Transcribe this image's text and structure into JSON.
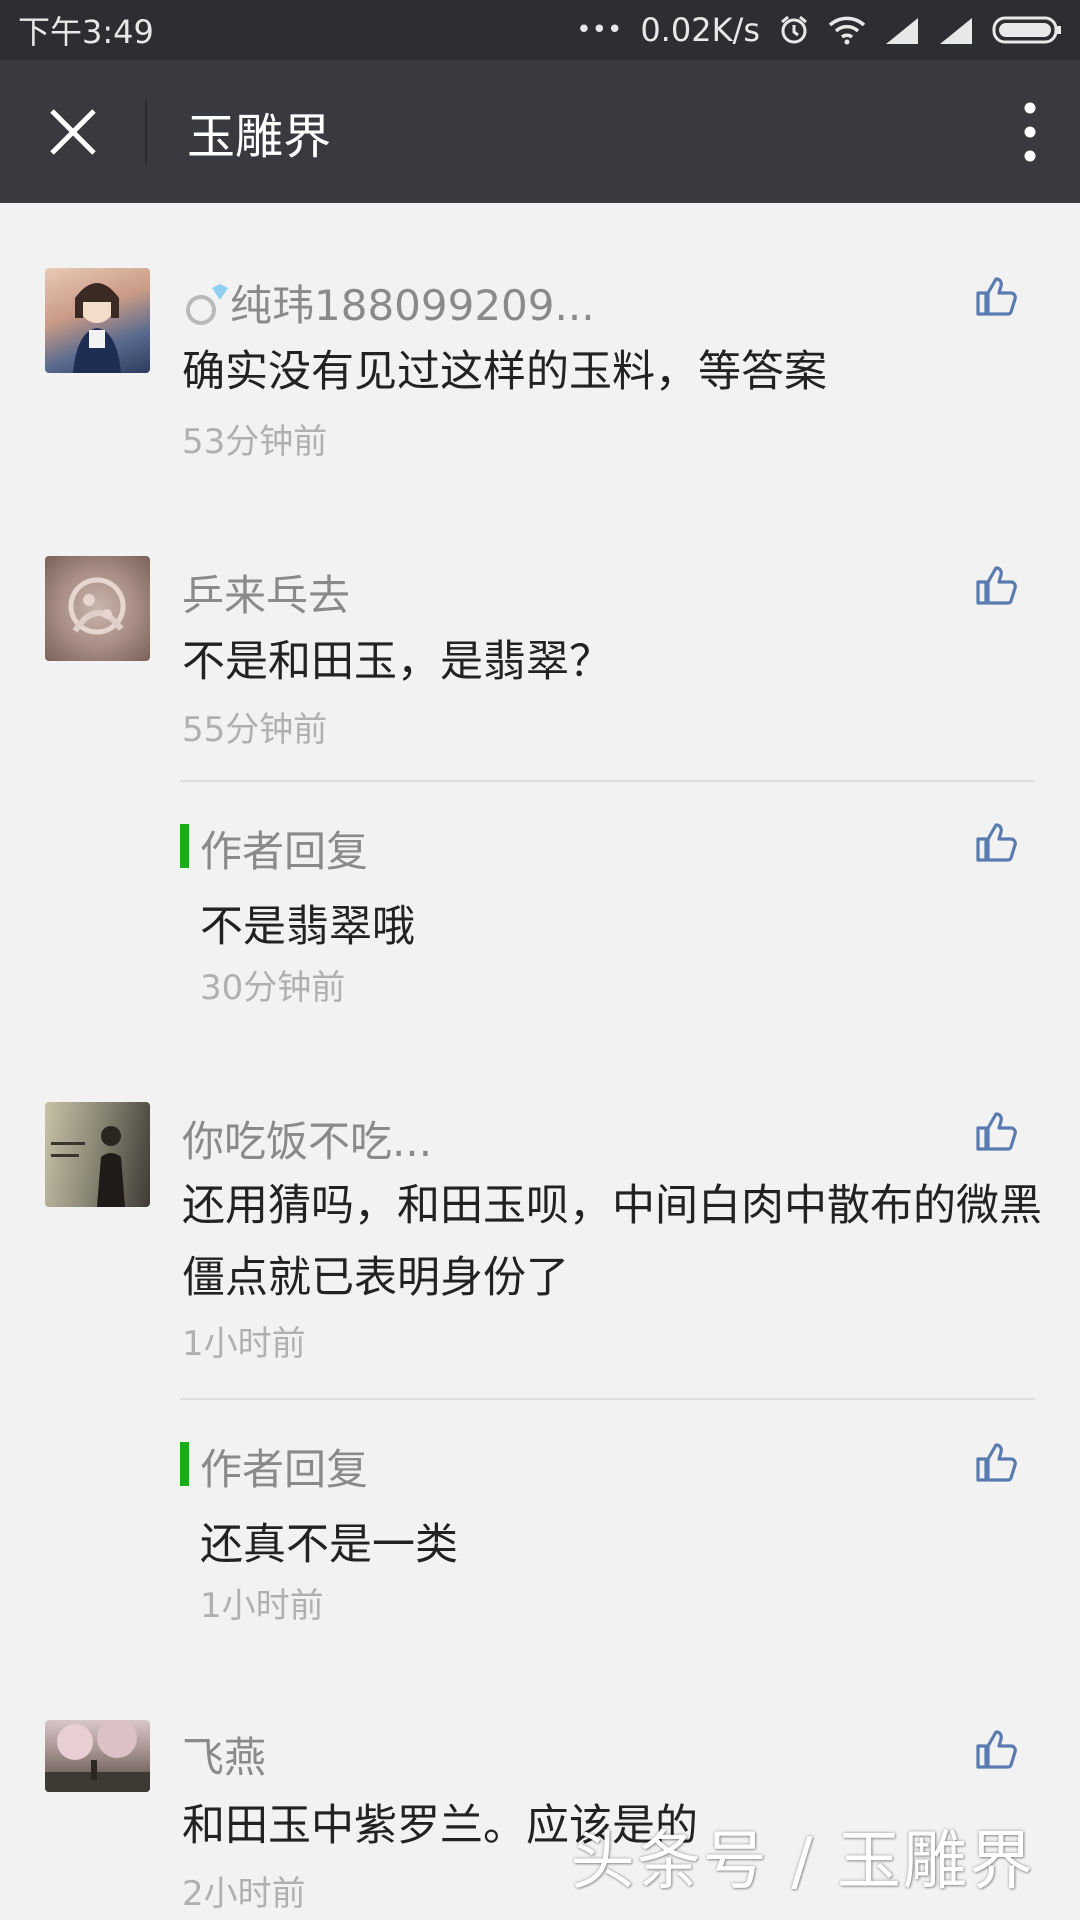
{
  "status_bar": {
    "time": "下午3:49",
    "dots": "•••",
    "net_speed": "0.02K/s"
  },
  "header": {
    "title": "玉雕界"
  },
  "comments": [
    {
      "nickname": "纯玮188099209...",
      "content": "确实没有见过这样的玉料，等答案",
      "time": "53分钟前"
    },
    {
      "nickname": "乒来乓去",
      "content": "不是和田玉，是翡翠？",
      "time": "55分钟前",
      "reply": {
        "label": "作者回复",
        "content": "不是翡翠哦",
        "time": "30分钟前"
      }
    },
    {
      "nickname": "你吃饭不吃...",
      "content": "还用猜吗，和田玉呗，中间白肉中散布的微黑僵点就已表明身份了",
      "time": "1小时前",
      "reply": {
        "label": "作者回复",
        "content": "还真不是一类",
        "time": "1小时前"
      }
    },
    {
      "nickname": "飞燕",
      "content": "和田玉中紫罗兰。应该是的",
      "time": "2小时前"
    }
  ],
  "watermark": "头条号 / 玉雕界",
  "colors": {
    "accent_green": "#1aad19",
    "like_blue": "#5a7bb0",
    "header_bg": "#393a3f"
  }
}
